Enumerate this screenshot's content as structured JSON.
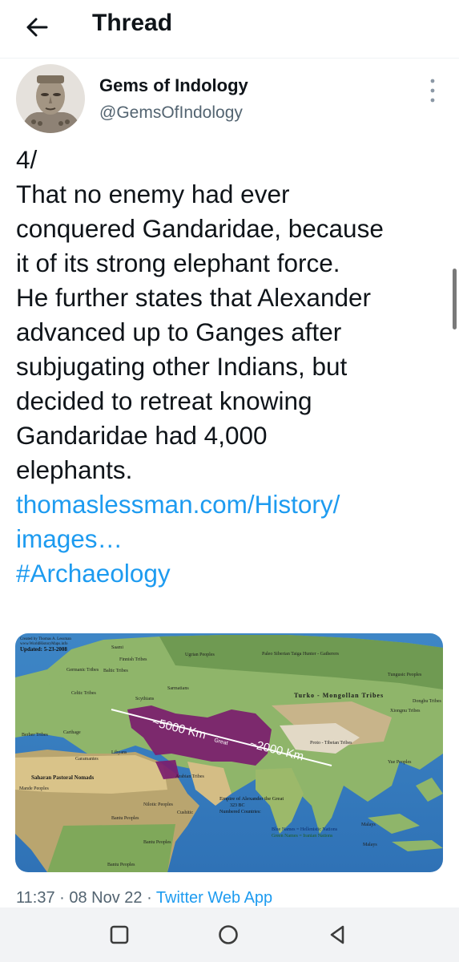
{
  "header": {
    "title": "Thread",
    "back_icon": "arrow-left-icon"
  },
  "tweet": {
    "author_name": "Gems of Indology",
    "author_handle": "@GemsOfIndology",
    "text_lines": [
      "4/",
      "That no enemy had ever",
      "conquered Gandaridae, because",
      "it of its strong elephant force.",
      "He further states that Alexander",
      "advanced up to Ganges after",
      "subjugating other Indians, but",
      "decided to retreat knowing",
      "Gandaridae had 4,000",
      "elephants."
    ],
    "link_lines": [
      "thomaslessman.com/History/",
      "images…"
    ],
    "hashtag": "#Archaeology",
    "timestamp": "11:37 · 08 Nov 22 · ",
    "source_app": "Twitter Web App"
  },
  "map": {
    "credit_line_1": "Created by Thomas A. Lessman",
    "credit_line_2": "www.WorldHistoryMaps.info",
    "updated": "Updated: 5-23-2008",
    "labels": {
      "saami": "Saami",
      "finnish": "Finnish Tribes",
      "baltic": "Baltic Tribes",
      "ugrian": "Ugrian Peoples",
      "paleo": "Paleo Siberian Taiga Hunter - Gatherers",
      "tungusic": "Tungusic Peoples",
      "germanic": "Germanic Tribes",
      "celtic": "Celtic Tribes",
      "sarmatians": "Sarmatians",
      "turko": "Turko - Mongollan   Tribes",
      "scythians": "Scythians",
      "xiongnu": "Xiongnu Tribes",
      "donghu": "Donghu Tribes",
      "berber": "Berber Tribes",
      "carthage": "Carthage",
      "proto_tibetan": "Proto - Tibetan Tribes",
      "garamantes": "Garamantes",
      "libyans": "Libyans",
      "arabian": "Arabian Tribes",
      "yue": "Yue Peoples",
      "saharan": "Saharan Pastoral Nomads",
      "mande": "Mande Peoples",
      "bantu_1": "Bantu Peoples",
      "bantu_2": "Bantu Peoples",
      "bantu_3": "Bantu Peoples",
      "nilotic": "Nilotic Peoples",
      "cushitic": "Cushitic",
      "malays_1": "Malays",
      "malays_2": "Malays",
      "empire_title": "Empire of Alexander the Great",
      "empire_year": "323 BC",
      "numbered": "Numbered Countries:",
      "legend_blue": "Blue Names = Hellenistic Nations",
      "legend_green": "Green Names = Iranian Nations",
      "distance_west": "~5000 Km",
      "distance_east": "~2000 Km",
      "great": "Great"
    }
  },
  "navbar": {
    "recent_icon": "square-icon",
    "home_icon": "circle-icon",
    "back_icon": "triangle-back-icon"
  },
  "colors": {
    "link": "#1d9bf0",
    "secondary_text": "#536471",
    "primary_text": "#0f1419",
    "empire": "#7b1d6e"
  }
}
